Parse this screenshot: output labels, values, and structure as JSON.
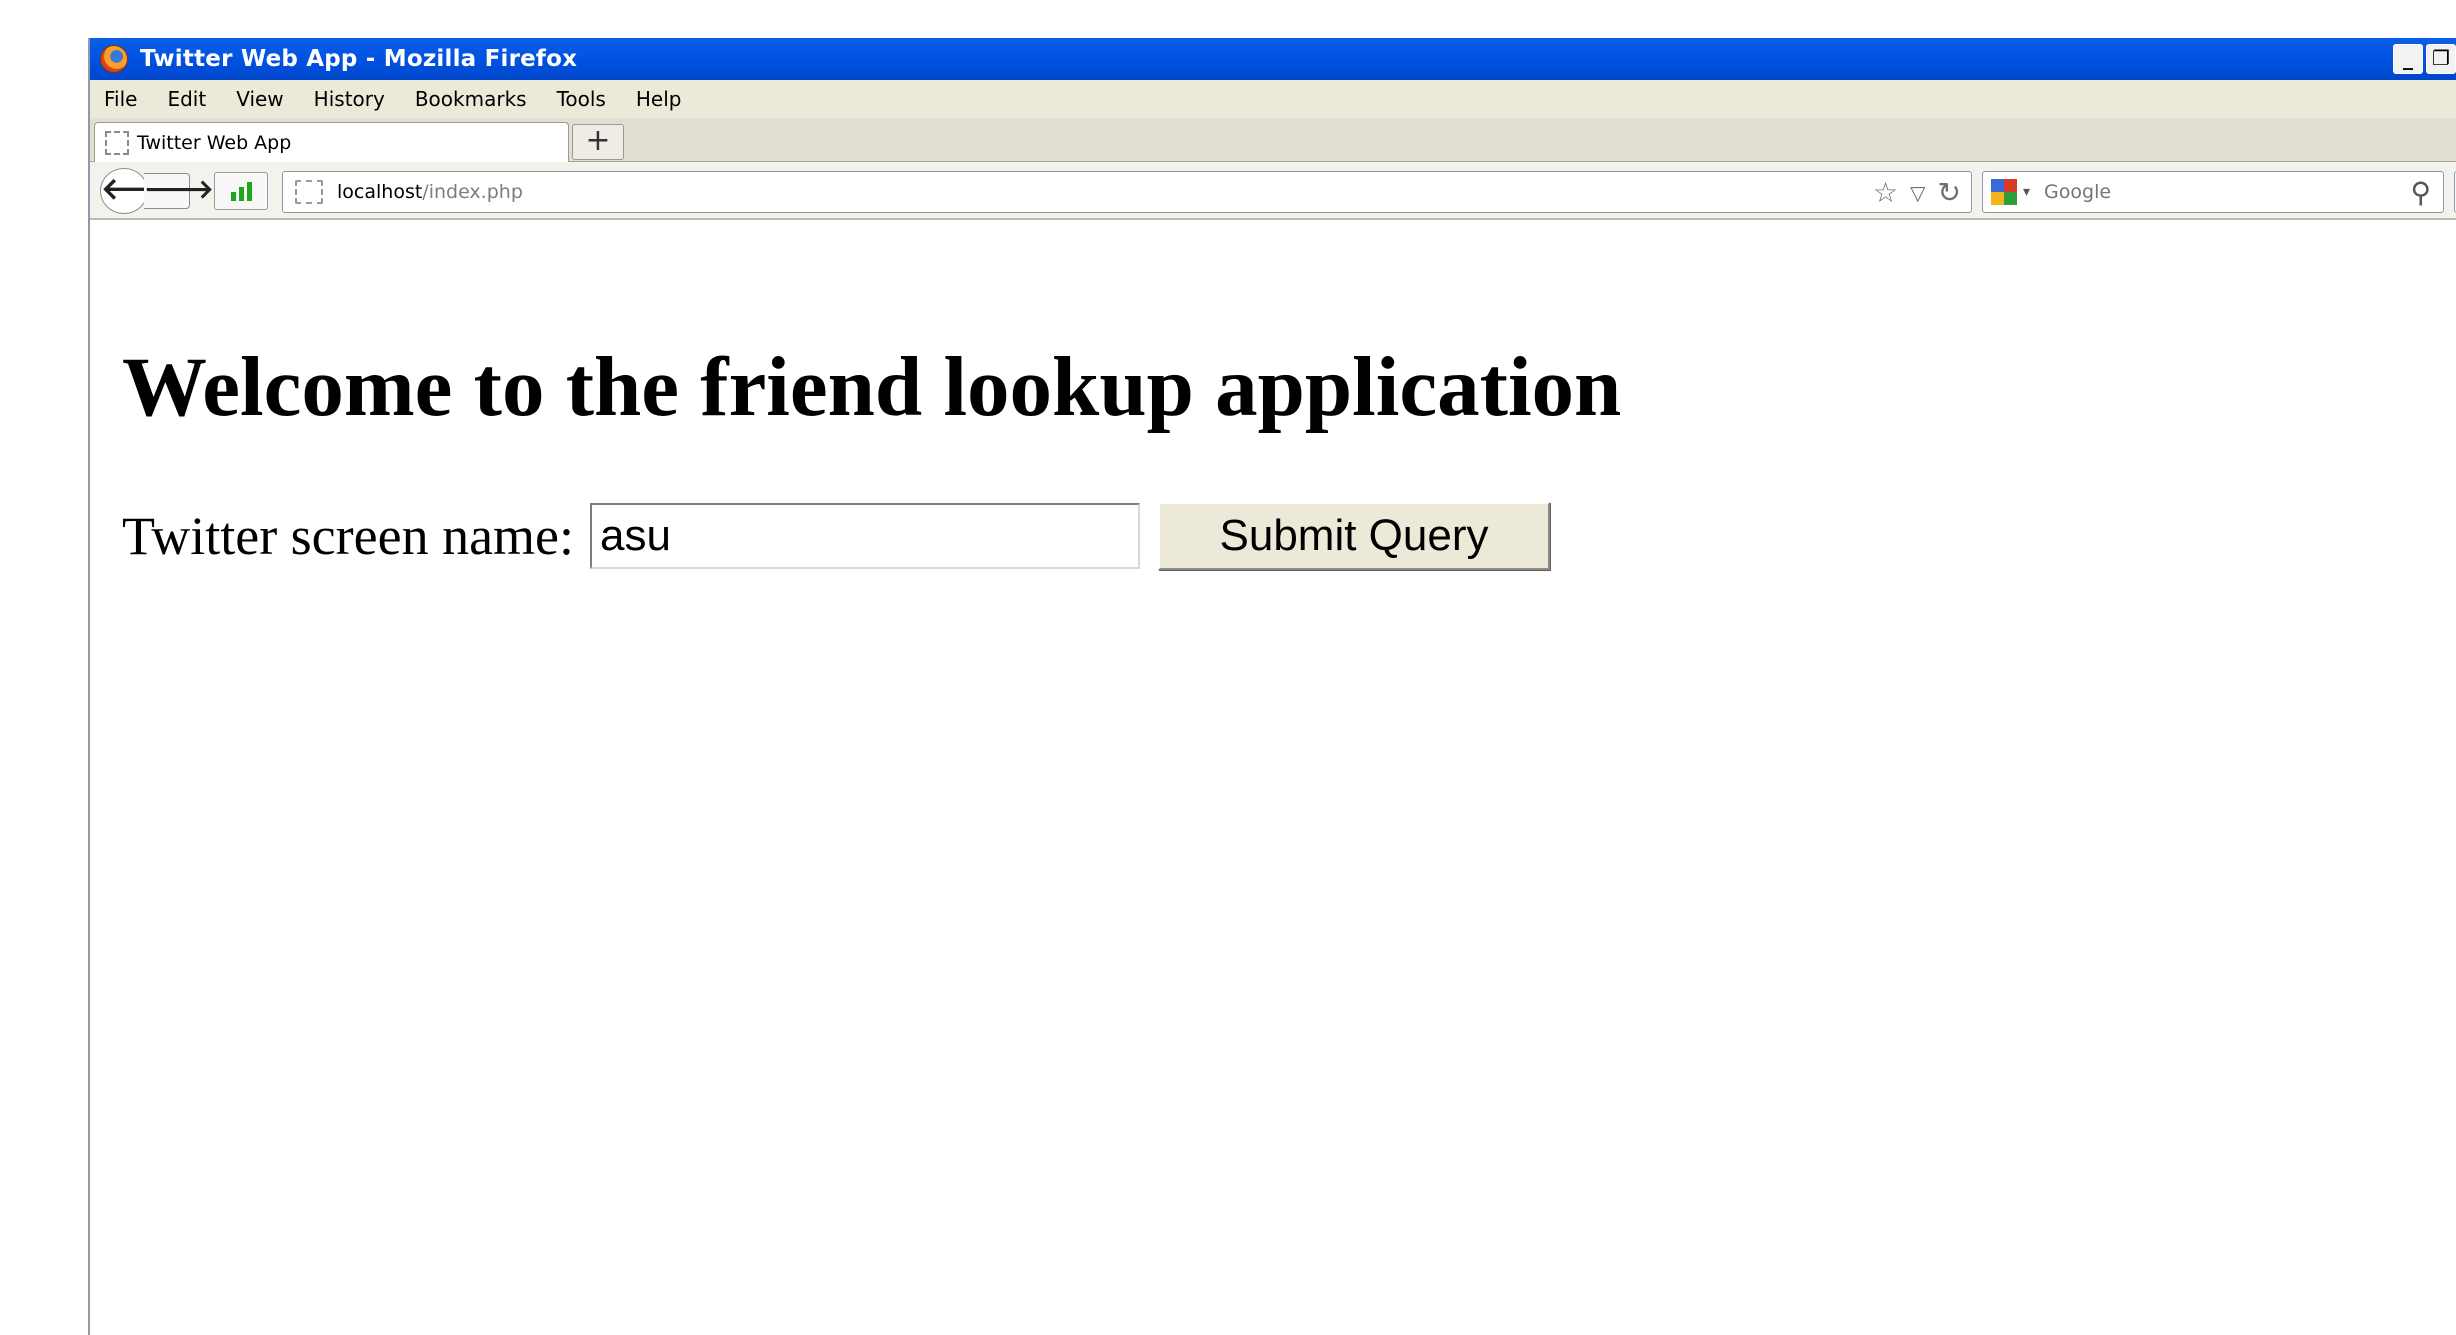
{
  "window": {
    "title": "Twitter Web App - Mozilla Firefox",
    "controls": {
      "minimize": "_",
      "restore": "❐"
    }
  },
  "menu": [
    "File",
    "Edit",
    "View",
    "History",
    "Bookmarks",
    "Tools",
    "Help"
  ],
  "tab": {
    "label": "Twitter Web App",
    "new_tab": "+"
  },
  "nav": {
    "back": "🡐",
    "forward": "🡒",
    "url_host": "localhost",
    "url_path": "/index.php",
    "bookmark_star": "☆",
    "history_drop": "▽",
    "reload": "↻",
    "search_placeholder": "Google",
    "search_drop": "▾",
    "magnifier": "⚲"
  },
  "page": {
    "title": "Welcome to the friend lookup application",
    "label": "Twitter screen name:",
    "input_value": "asu",
    "submit_label": "Submit Query"
  },
  "colors": {
    "titlebar": "#0050df",
    "signal_green": "#22a51a",
    "google_blue": "#3b6ad6",
    "google_red": "#d8392b",
    "google_yellow": "#f2b61b",
    "google_green": "#2e9d3a"
  },
  "icons": {
    "app": "firefox-icon",
    "tab_favicon": "blank-page-icon",
    "signal": "signal-bars-icon",
    "search_engine": "google-icon"
  }
}
